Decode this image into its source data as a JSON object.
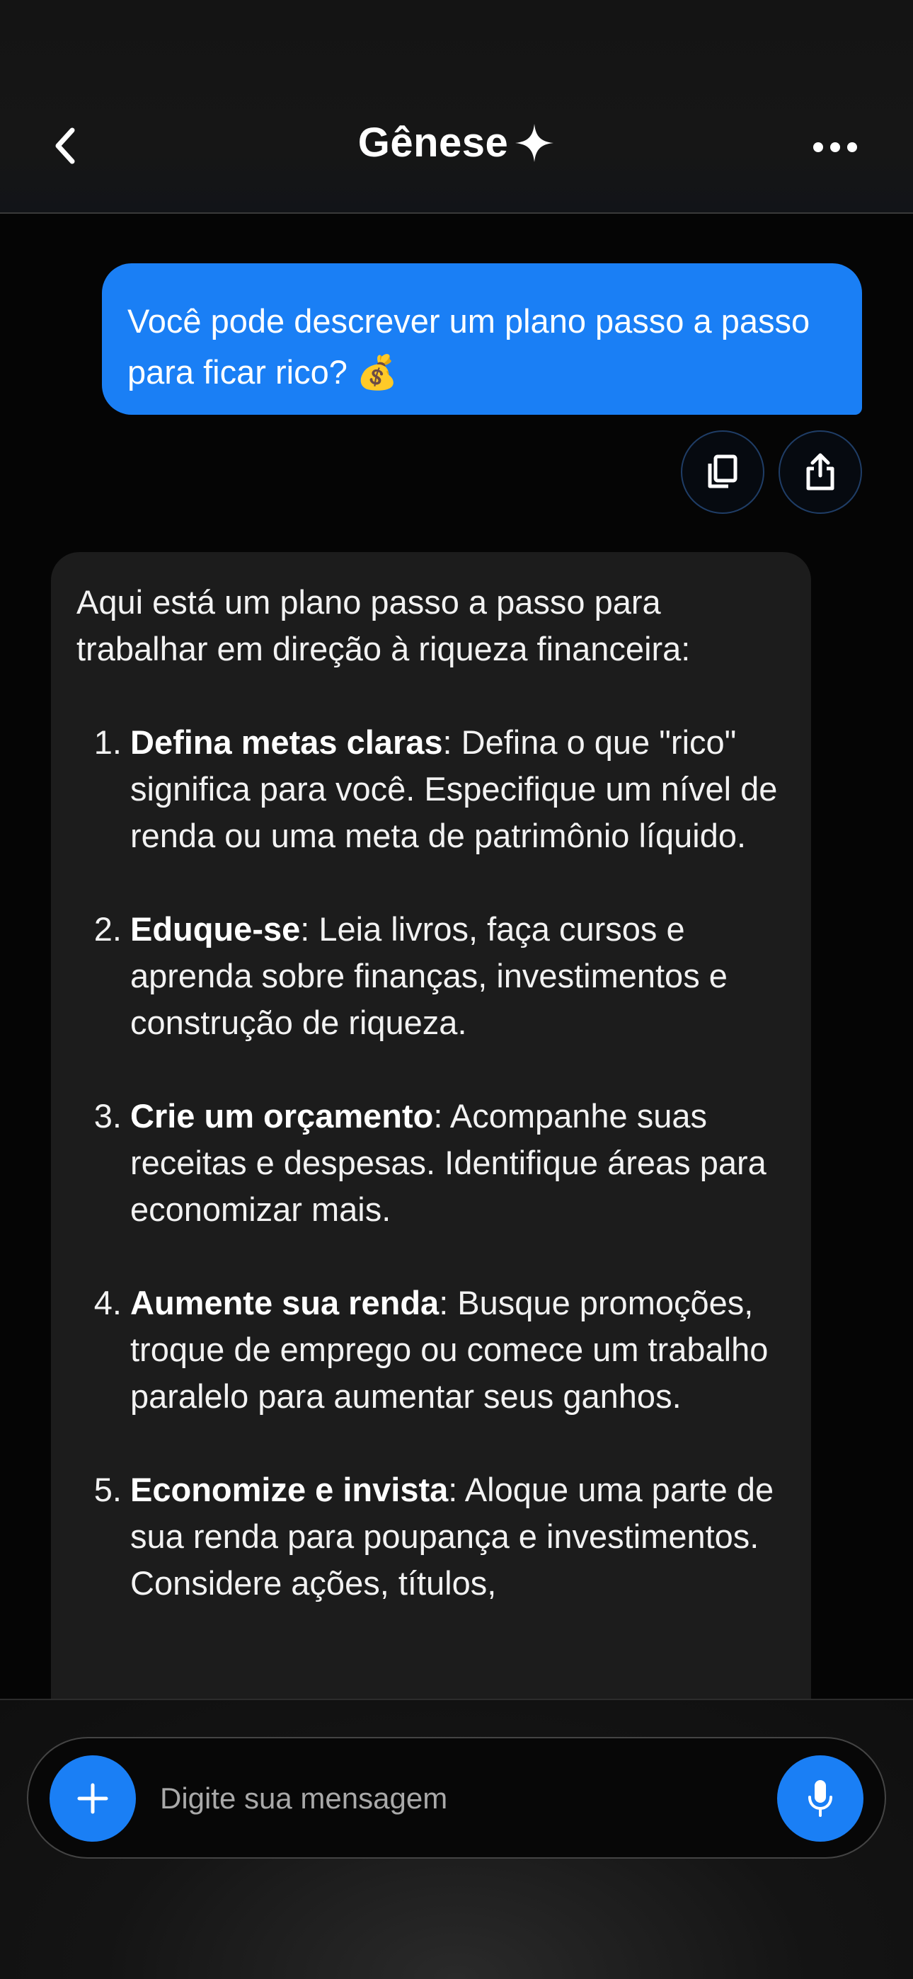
{
  "header": {
    "title": "Gênese",
    "back_icon": "chevron-left-icon",
    "title_icon": "sparkle-icon",
    "menu_icon": "ellipsis-icon"
  },
  "conversation": {
    "user_message": {
      "text": "Você pode descrever um plano passo a passo para ficar rico? 💰",
      "actions": [
        {
          "icon": "copy-icon"
        },
        {
          "icon": "share-icon"
        }
      ]
    },
    "assistant_message": {
      "intro": "Aqui está um plano passo a passo para trabalhar em direção à riqueza financeira:",
      "steps": [
        {
          "number": "1.",
          "title": "Defina metas claras",
          "text": ": Defina o que \"rico\" significa para você. Especifique um nível de renda ou uma meta de patrimônio líquido."
        },
        {
          "number": "2.",
          "title": "Eduque-se",
          "text": ": Leia livros, faça cursos e aprenda sobre finanças, investimentos e construção de riqueza."
        },
        {
          "number": "3.",
          "title": "Crie um orçamento",
          "text": ": Acompanhe suas receitas e despesas. Identifique áreas para economizar mais."
        },
        {
          "number": "4.",
          "title": "Aumente sua renda",
          "text": ": Busque promoções, troque de emprego ou comece um trabalho paralelo para aumentar seus ganhos."
        },
        {
          "number": "5.",
          "title": "Economize e invista",
          "text": ": Aloque uma parte de sua renda para poupança e investimentos. Considere ações, títulos,"
        }
      ]
    }
  },
  "composer": {
    "placeholder": "Digite sua mensagem",
    "add_icon": "plus-icon",
    "mic_icon": "microphone-icon"
  },
  "colors": {
    "accent": "#1a7ff5",
    "background": "#050505",
    "assistant_bubble": "#1c1c1c"
  }
}
